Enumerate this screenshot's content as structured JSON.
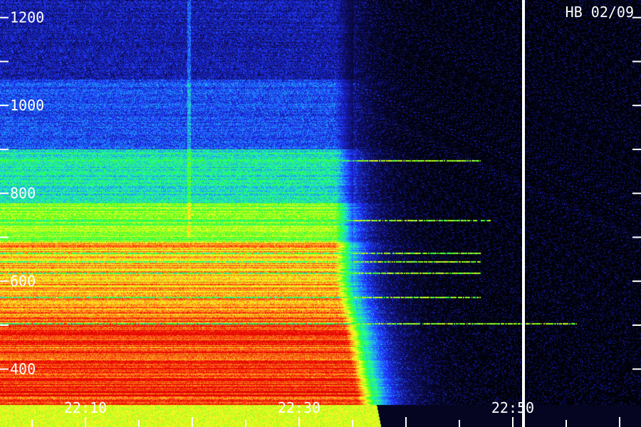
{
  "header": {
    "station_label": "HB 02/09"
  },
  "chart_data": {
    "type": "heatmap",
    "title": "",
    "xlabel": "",
    "ylabel": "",
    "x_tick_labels": [
      "22:10",
      "22:30",
      "22:50"
    ],
    "x_ticks_minutes": [
      10,
      30,
      50
    ],
    "xlim_minutes": [
      2,
      62
    ],
    "y_tick_labels": [
      "400",
      "600",
      "800",
      "1000",
      "1200"
    ],
    "y_ticks": [
      400,
      600,
      800,
      1000,
      1200
    ],
    "ylim": [
      320,
      1240
    ],
    "marker_time_minutes": 51,
    "colorscale": [
      "#000000",
      "#101070",
      "#2030ff",
      "#20a0ff",
      "#20ffa0",
      "#30ff20",
      "#c0ff20",
      "#ffff20",
      "#ffa020",
      "#ff3010",
      "#e00000"
    ],
    "emission_bands": [
      {
        "freq_low": 320,
        "freq_high": 520,
        "level": 0.92
      },
      {
        "freq_low": 520,
        "freq_high": 690,
        "level": 0.78
      },
      {
        "freq_low": 690,
        "freq_high": 780,
        "level": 0.55
      },
      {
        "freq_low": 780,
        "freq_high": 900,
        "level": 0.38
      },
      {
        "freq_low": 900,
        "freq_high": 1060,
        "level": 0.22
      },
      {
        "freq_low": 1060,
        "freq_high": 1240,
        "level": 0.14
      }
    ],
    "emission_end_minutes": 35,
    "narrowband_lines": [
      {
        "freq": 505,
        "end_minutes": 56
      },
      {
        "freq": 565,
        "end_minutes": 47
      },
      {
        "freq": 620,
        "end_minutes": 47
      },
      {
        "freq": 645,
        "end_minutes": 47
      },
      {
        "freq": 665,
        "end_minutes": 47
      },
      {
        "freq": 740,
        "end_minutes": 48
      },
      {
        "freq": 875,
        "end_minutes": 47
      }
    ]
  }
}
